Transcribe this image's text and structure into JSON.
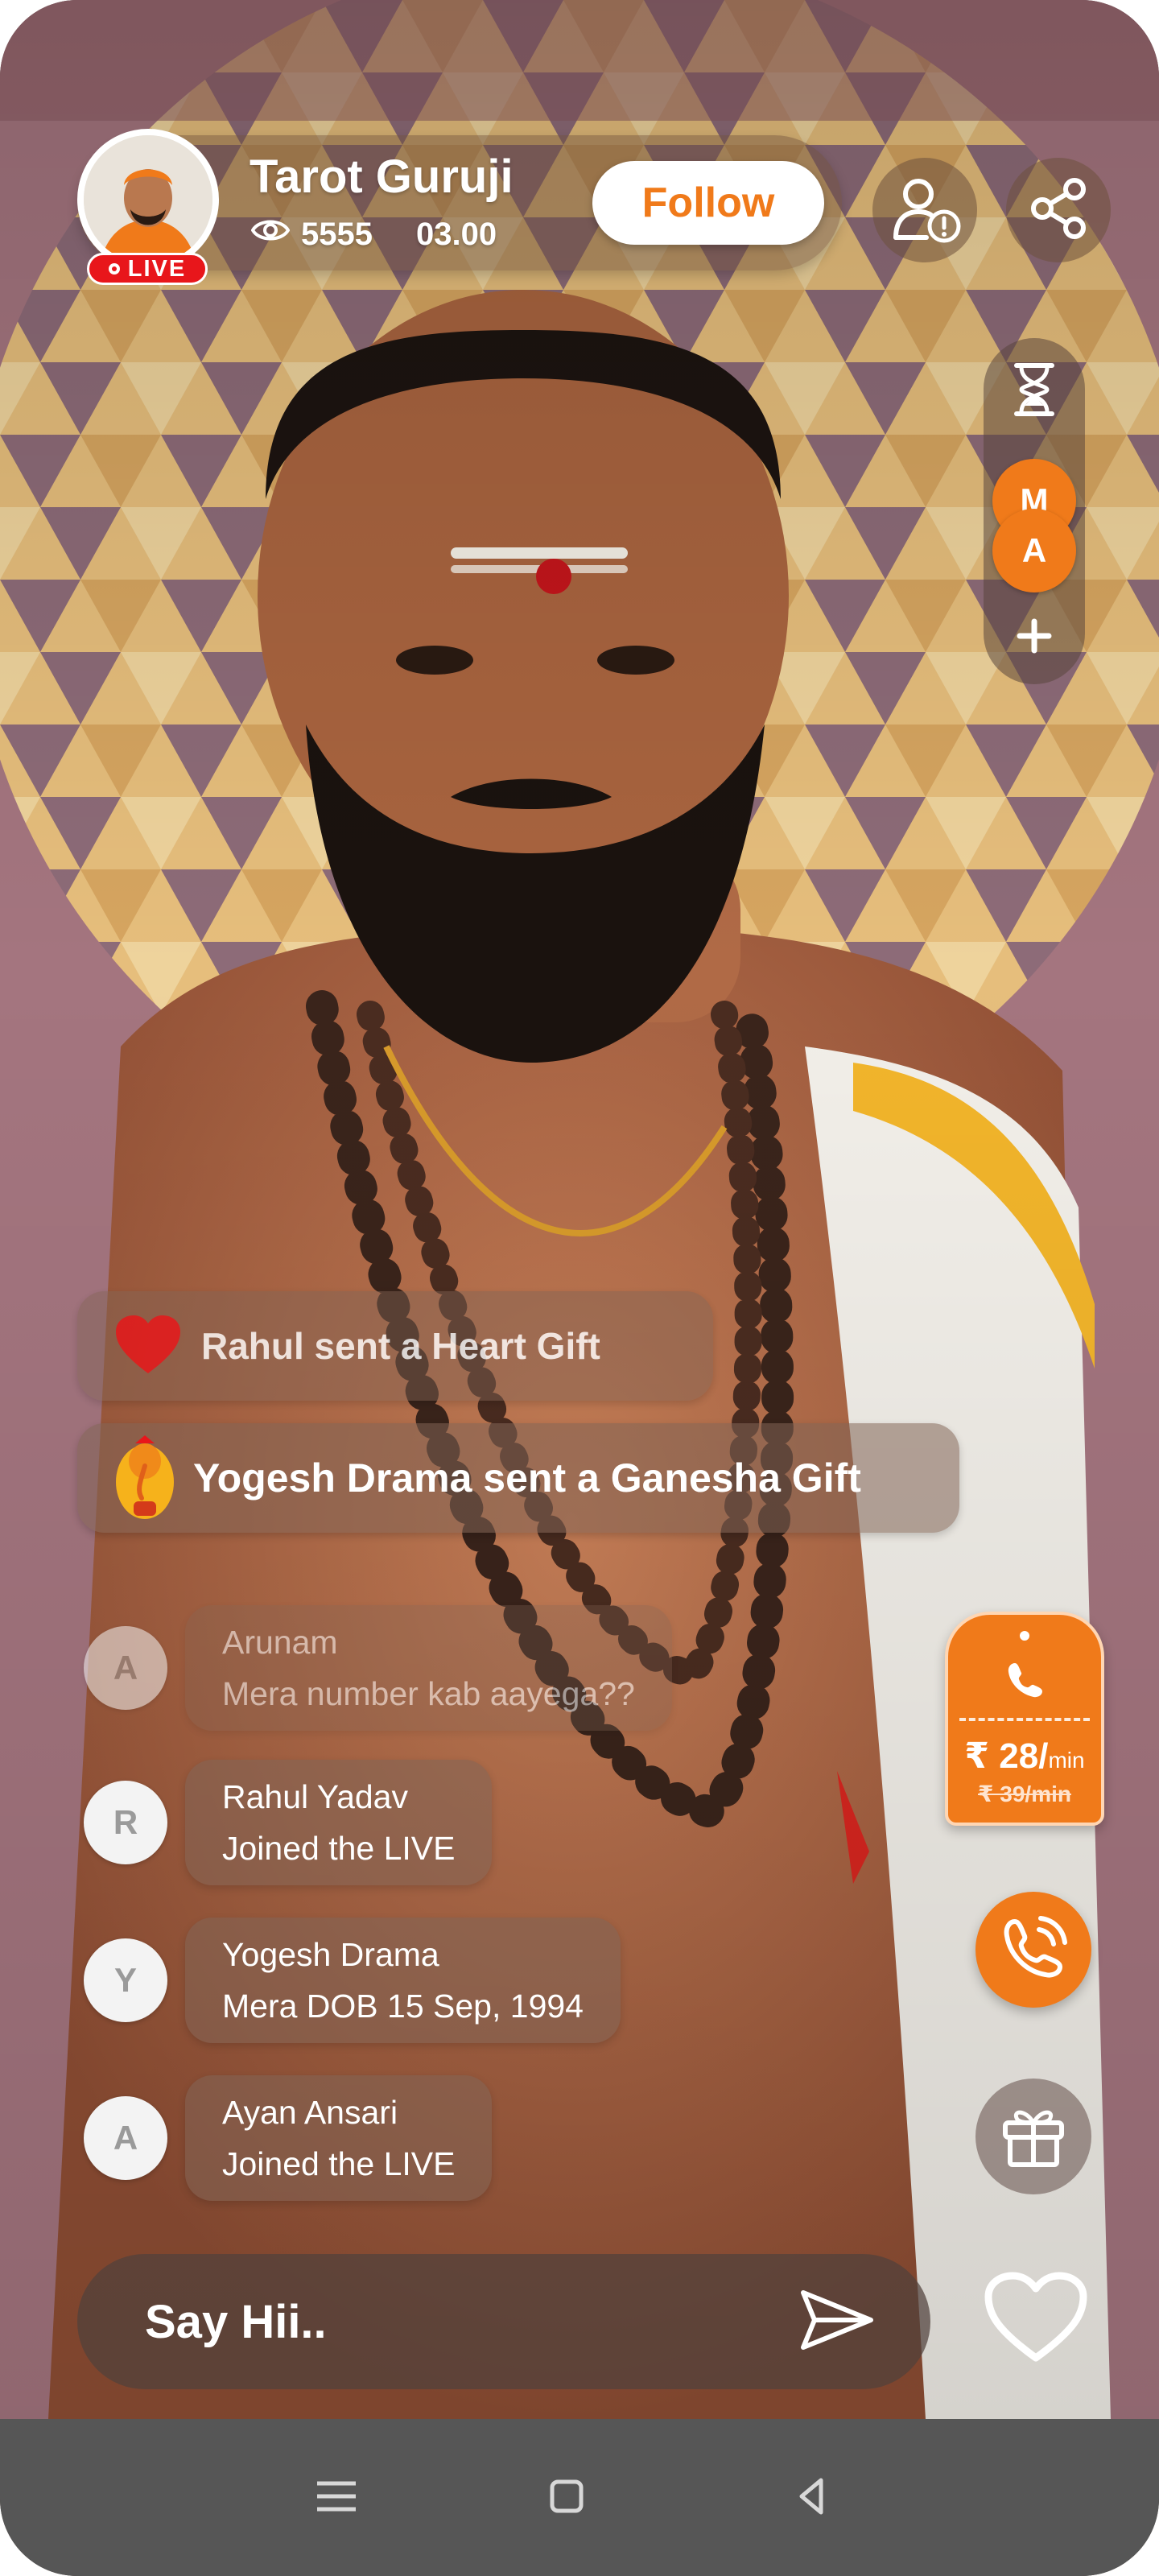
{
  "host": {
    "name": "Tarot Guruji",
    "live_label": "LIVE",
    "viewers": "5555",
    "duration": "03.00",
    "follow_label": "Follow"
  },
  "top_actions": {
    "report_icon": "user-alert-icon",
    "share_icon": "share-icon"
  },
  "queue": {
    "timer_icon": "hourglass-icon",
    "avatars": [
      "M",
      "A"
    ],
    "add_icon": "plus-icon"
  },
  "gift_notices": [
    {
      "icon": "heart-icon",
      "text": "Rahul sent a Heart Gift"
    },
    {
      "icon": "ganesha-icon",
      "text": "Yogesh Drama sent a Ganesha Gift"
    }
  ],
  "chat": [
    {
      "initial": "A",
      "name": "Arunam",
      "message": "Mera number kab aayega??"
    },
    {
      "initial": "R",
      "name": "Rahul Yadav",
      "message": "Joined the LIVE"
    },
    {
      "initial": "Y",
      "name": "Yogesh Drama",
      "message": "Mera DOB 15 Sep, 1994"
    },
    {
      "initial": "A",
      "name": "Ayan Ansari",
      "message": "Joined the LIVE"
    }
  ],
  "call_rate": {
    "price": "₹ 28/",
    "unit": "min",
    "old_price": "₹ 39/min"
  },
  "composer": {
    "placeholder": "Say Hii.."
  },
  "colors": {
    "accent": "#f07a1a",
    "live_red": "#e8161b",
    "nav_bar": "#565656"
  }
}
